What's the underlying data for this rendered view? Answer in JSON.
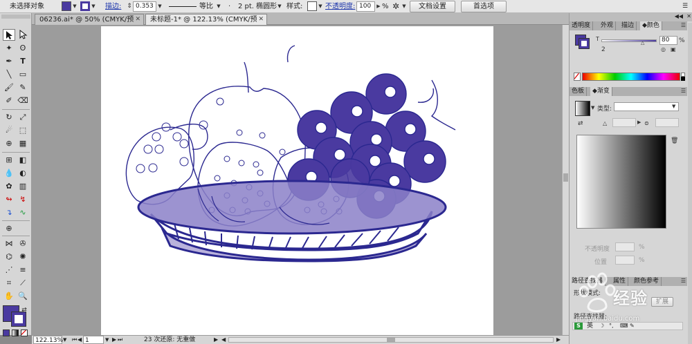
{
  "control_bar": {
    "selection": "未选择对象",
    "fill_color": "#4a3aa0",
    "stroke_color": "#4a3aa0",
    "stroke_label": "描边:",
    "stroke_value": "0.353",
    "profile_label": "等比",
    "brush_value": "2 pt. 椭圆形",
    "style_label": "样式:",
    "opacity_label": "不透明度:",
    "opacity_value": "100",
    "opacity_unit": "%",
    "doc_setup_button": "文档设置",
    "preferences_button": "首选项"
  },
  "doc_tabs": [
    {
      "label": "06236.ai* @ 50% (CMYK/预览)",
      "active": false
    },
    {
      "label": "未标题-1* @ 122.13% (CMYK/预览)",
      "active": true
    }
  ],
  "status_bar": {
    "zoom": "122.13%",
    "page": "1",
    "status_text": "23 次还原: 无重做"
  },
  "panels": {
    "color_panel": {
      "tabs": [
        "透明度",
        "外观",
        "描边",
        "颜色"
      ],
      "active_tab": "颜色",
      "t_label": "T",
      "t_value": "80",
      "t_unit": "%",
      "stroke_small": "2",
      "fill": "#4a3aa0"
    },
    "gradient_panel": {
      "tabs": [
        "色板",
        "渐变"
      ],
      "active_tab": "渐变",
      "type_label": "类型:",
      "type_value": "",
      "opacity_label": "不透明度",
      "opacity_unit": "%",
      "position_label": "位置",
      "position_unit": "%"
    },
    "bottom_panel": {
      "tabs": [
        "路径查找器",
        "属性",
        "颜色参考"
      ],
      "active_tab": "路径查找器",
      "mode_label": "形状模式:",
      "expand_button": "扩展",
      "pathfinder_label": "路径查找器:"
    }
  },
  "ime": {
    "mode": "英"
  },
  "watermark": {
    "brand": "经验",
    "url": "jingyan.baidu.com",
    "color": "#ffffff"
  },
  "artwork_colors": {
    "stroke": "#2b2890",
    "grape_fill": "#4a3aa0",
    "plate_top": "#8b80c8",
    "plate_body": "#b9b2dc"
  }
}
